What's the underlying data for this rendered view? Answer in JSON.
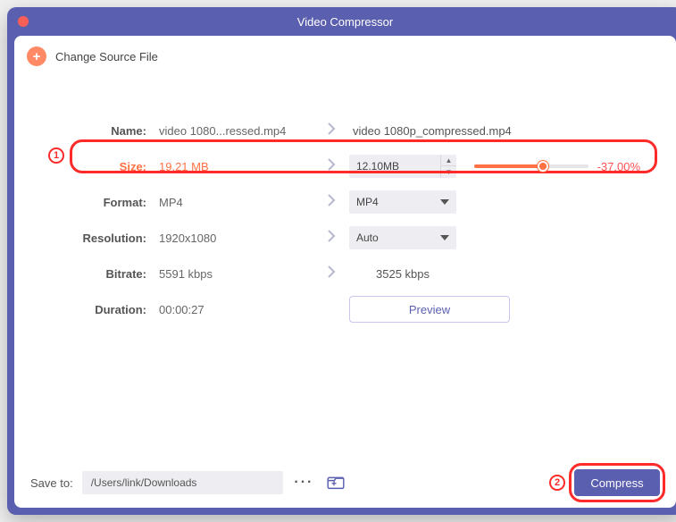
{
  "window": {
    "title": "Video Compressor"
  },
  "header": {
    "change_source": "Change Source File"
  },
  "labels": {
    "name": "Name:",
    "size": "Size:",
    "format": "Format:",
    "resolution": "Resolution:",
    "bitrate": "Bitrate:",
    "duration": "Duration:",
    "save_to": "Save to:"
  },
  "values": {
    "name_in": "video 1080...ressed.mp4",
    "name_out": "video 1080p_compressed.mp4",
    "size_in": "19.21 MB",
    "size_out": "12.10MB",
    "size_pct": "-37.00%",
    "size_slider_pct": 60,
    "format_in": "MP4",
    "format_out": "MP4",
    "resolution_in": "1920x1080",
    "resolution_out": "Auto",
    "bitrate_in": "5591 kbps",
    "bitrate_out": "3525 kbps",
    "duration": "00:00:27"
  },
  "buttons": {
    "preview": "Preview",
    "compress": "Compress"
  },
  "footer": {
    "path": "/Users/link/Downloads"
  },
  "annotations": {
    "a1": "1",
    "a2": "2"
  }
}
